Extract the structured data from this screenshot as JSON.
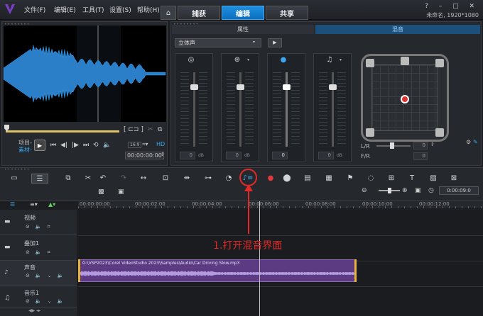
{
  "menu": {
    "file": "文件(F)",
    "edit": "编辑(E)",
    "tools": "工具(T)",
    "settings": "设置(S)",
    "help": "帮助(H)"
  },
  "tabs": {
    "home": "⌂",
    "capture": "捕获",
    "edit": "编辑",
    "share": "共享"
  },
  "window": {
    "controls": "? – □ ✕",
    "project_info": "未命名, 1920*1080"
  },
  "player": {
    "mode_project": "项目-",
    "mode_clip": "素材-",
    "hd": "HD",
    "timecode": "00:00:00:00",
    "zoom_label": "16:9"
  },
  "mixer": {
    "tab_properties": "属性",
    "tab_mixing": "混音",
    "stereo_select": "立体声",
    "channels": [
      {
        "value": "0",
        "db": "dB",
        "level": 0.2,
        "active": false
      },
      {
        "value": "0",
        "db": "dB",
        "level": 0.2,
        "active": false
      },
      {
        "value": "0",
        "db": "",
        "level": 0.2,
        "active": true
      },
      {
        "value": "0",
        "db": "dB",
        "level": 0.2,
        "active": false
      }
    ],
    "lr_label": "L/R",
    "fr_label": "F/R",
    "lr_value": "0",
    "fr_value": "0"
  },
  "toolbar": {
    "timecode": "0:00:09:0"
  },
  "ruler": {
    "ticks": [
      "00:00:00:00",
      "00:00:02:00",
      "00:00:04:00",
      "00:00:06:00",
      "00:00:08:00",
      "00:00:10:00",
      "00:00:12:00"
    ]
  },
  "tracks": {
    "video": "视频",
    "overlay": "叠加1",
    "voice": "声音",
    "music": "音乐1"
  },
  "clip": {
    "path": "G:\\VSP2023\\Corel VideoStudio 2023\\Samples\\Audio\\Car Driving Slow.mp3"
  },
  "annotation": {
    "text": "1.打开混音界面"
  },
  "colors": {
    "accent": "#0b6fbf",
    "annotation": "#e02a2a",
    "clip": "#5c3b82"
  }
}
